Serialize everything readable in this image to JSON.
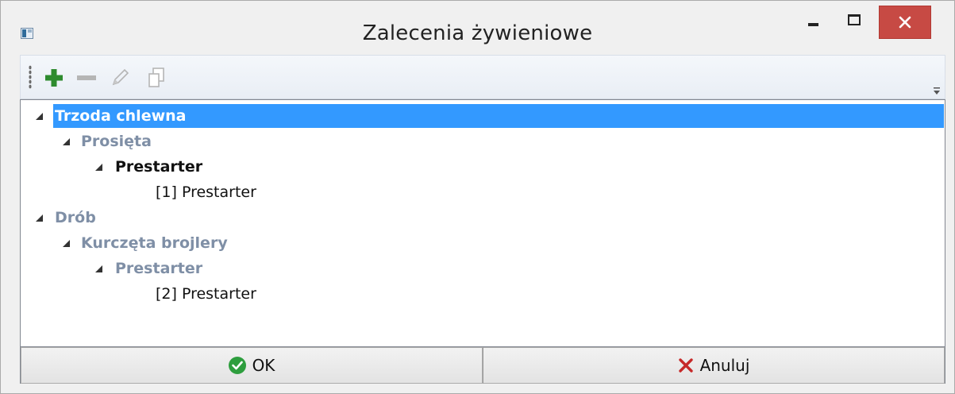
{
  "window": {
    "title": "Zalecenia żywieniowe",
    "icon": "app-icon",
    "controls": [
      "minimize-icon",
      "maximize-icon",
      "close-icon"
    ],
    "close_color": "#c74a44"
  },
  "toolbar": {
    "buttons": [
      {
        "name": "add",
        "icon": "plus-icon",
        "color": "#2e8b2e"
      },
      {
        "name": "remove",
        "icon": "minus-icon",
        "color": "#b5b5b5"
      },
      {
        "name": "edit",
        "icon": "pencil-icon",
        "color": "#b5b5b5"
      },
      {
        "name": "copy",
        "icon": "copy-icon",
        "color": "#b5b5b5"
      }
    ]
  },
  "tree": {
    "selection_color": "#3399ff",
    "nodes": [
      {
        "label": "Trzoda chlewna",
        "level": 0,
        "expanded": true,
        "selected": true,
        "style": "bold"
      },
      {
        "label": "Prosięta",
        "level": 1,
        "expanded": true,
        "style": "bold-gray"
      },
      {
        "label": "Prestarter",
        "level": 2,
        "expanded": true,
        "style": "bold"
      },
      {
        "label": "[1] Prestarter",
        "level": 3,
        "leaf": true,
        "style": "normal"
      },
      {
        "label": "Drób",
        "level": 0,
        "expanded": true,
        "style": "bold-gray"
      },
      {
        "label": "Kurczęta brojlery",
        "level": 1,
        "expanded": true,
        "style": "bold-gray"
      },
      {
        "label": "Prestarter",
        "level": 2,
        "expanded": true,
        "style": "bold-gray"
      },
      {
        "label": "[2] Prestarter",
        "level": 3,
        "leaf": true,
        "style": "normal"
      }
    ]
  },
  "footer": {
    "ok_label": "OK",
    "ok_icon": "check-circle-icon",
    "cancel_label": "Anuluj",
    "cancel_icon": "x-icon",
    "cancel_color": "#c62828"
  }
}
